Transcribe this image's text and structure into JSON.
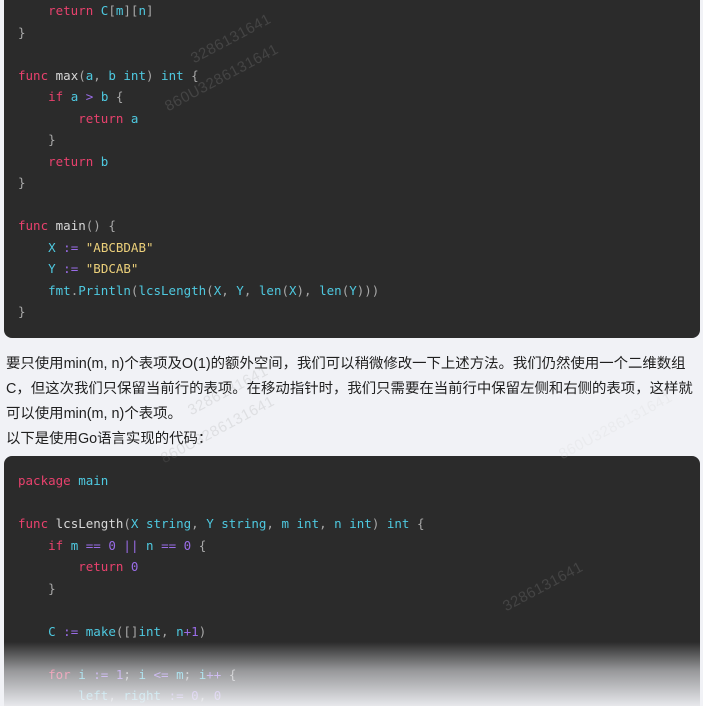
{
  "page": {
    "background_color": "#f1f2f6",
    "code_background_color": "#2b2b2b",
    "text_color": "#1f1f1f"
  },
  "watermark": {
    "text": "860U3286131641",
    "short_text": "3286131641"
  },
  "code_block_1": {
    "language": "go",
    "lines": [
      [
        {
          "t": "    ",
          "c": "pn"
        },
        {
          "t": "return",
          "c": "kw"
        },
        {
          "t": " ",
          "c": "pn"
        },
        {
          "t": "C",
          "c": "typ"
        },
        {
          "t": "[",
          "c": "pn"
        },
        {
          "t": "m",
          "c": "typ"
        },
        {
          "t": "][",
          "c": "pn"
        },
        {
          "t": "n",
          "c": "typ"
        },
        {
          "t": "]",
          "c": "pn"
        }
      ],
      [
        {
          "t": "}",
          "c": "pn"
        }
      ],
      [],
      [
        {
          "t": "func",
          "c": "kw"
        },
        {
          "t": " ",
          "c": "pn"
        },
        {
          "t": "max",
          "c": "fn"
        },
        {
          "t": "(",
          "c": "pn"
        },
        {
          "t": "a",
          "c": "typ"
        },
        {
          "t": ", ",
          "c": "pn"
        },
        {
          "t": "b",
          "c": "typ"
        },
        {
          "t": " ",
          "c": "pn"
        },
        {
          "t": "int",
          "c": "typ"
        },
        {
          "t": ") ",
          "c": "pn"
        },
        {
          "t": "int",
          "c": "typ"
        },
        {
          "t": " {",
          "c": "pn"
        }
      ],
      [
        {
          "t": "    ",
          "c": "pn"
        },
        {
          "t": "if",
          "c": "kw"
        },
        {
          "t": " ",
          "c": "pn"
        },
        {
          "t": "a",
          "c": "typ"
        },
        {
          "t": " ",
          "c": "pn"
        },
        {
          "t": ">",
          "c": "op"
        },
        {
          "t": " ",
          "c": "pn"
        },
        {
          "t": "b",
          "c": "typ"
        },
        {
          "t": " {",
          "c": "pn"
        }
      ],
      [
        {
          "t": "        ",
          "c": "pn"
        },
        {
          "t": "return",
          "c": "kw"
        },
        {
          "t": " ",
          "c": "pn"
        },
        {
          "t": "a",
          "c": "typ"
        }
      ],
      [
        {
          "t": "    }",
          "c": "pn"
        }
      ],
      [
        {
          "t": "    ",
          "c": "pn"
        },
        {
          "t": "return",
          "c": "kw"
        },
        {
          "t": " ",
          "c": "pn"
        },
        {
          "t": "b",
          "c": "typ"
        }
      ],
      [
        {
          "t": "}",
          "c": "pn"
        }
      ],
      [],
      [
        {
          "t": "func",
          "c": "kw"
        },
        {
          "t": " ",
          "c": "pn"
        },
        {
          "t": "main",
          "c": "fn"
        },
        {
          "t": "() {",
          "c": "pn"
        }
      ],
      [
        {
          "t": "    ",
          "c": "pn"
        },
        {
          "t": "X",
          "c": "typ"
        },
        {
          "t": " ",
          "c": "pn"
        },
        {
          "t": ":=",
          "c": "op"
        },
        {
          "t": " ",
          "c": "pn"
        },
        {
          "t": "\"ABCBDAB\"",
          "c": "str"
        }
      ],
      [
        {
          "t": "    ",
          "c": "pn"
        },
        {
          "t": "Y",
          "c": "typ"
        },
        {
          "t": " ",
          "c": "pn"
        },
        {
          "t": ":=",
          "c": "op"
        },
        {
          "t": " ",
          "c": "pn"
        },
        {
          "t": "\"BDCAB\"",
          "c": "str"
        }
      ],
      [
        {
          "t": "    ",
          "c": "pn"
        },
        {
          "t": "fmt",
          "c": "typ"
        },
        {
          "t": ".",
          "c": "pn"
        },
        {
          "t": "Println",
          "c": "typ"
        },
        {
          "t": "(",
          "c": "pn"
        },
        {
          "t": "lcsLength",
          "c": "typ"
        },
        {
          "t": "(",
          "c": "pn"
        },
        {
          "t": "X",
          "c": "typ"
        },
        {
          "t": ", ",
          "c": "pn"
        },
        {
          "t": "Y",
          "c": "typ"
        },
        {
          "t": ", ",
          "c": "pn"
        },
        {
          "t": "len",
          "c": "typ"
        },
        {
          "t": "(",
          "c": "pn"
        },
        {
          "t": "X",
          "c": "typ"
        },
        {
          "t": "), ",
          "c": "pn"
        },
        {
          "t": "len",
          "c": "typ"
        },
        {
          "t": "(",
          "c": "pn"
        },
        {
          "t": "Y",
          "c": "typ"
        },
        {
          "t": ")))",
          "c": "pn"
        }
      ],
      [
        {
          "t": "}",
          "c": "pn"
        }
      ]
    ]
  },
  "prose": {
    "paragraph": "要只使用min(m, n)个表项及O(1)的额外空间，我们可以稍微修改一下上述方法。我们仍然使用一个二维数组C，但这次我们只保留当前行的表项。在移动指针时，我们只需要在当前行中保留左侧和右侧的表项，这样就可以使用min(m, n)个表项。",
    "lead_in": "以下是使用Go语言实现的代码："
  },
  "code_block_2": {
    "language": "go",
    "lines": [
      [
        {
          "t": "package",
          "c": "kw"
        },
        {
          "t": " ",
          "c": "pn"
        },
        {
          "t": "main",
          "c": "typ"
        }
      ],
      [],
      [
        {
          "t": "func",
          "c": "kw"
        },
        {
          "t": " ",
          "c": "pn"
        },
        {
          "t": "lcsLength",
          "c": "fn"
        },
        {
          "t": "(",
          "c": "pn"
        },
        {
          "t": "X",
          "c": "typ"
        },
        {
          "t": " ",
          "c": "pn"
        },
        {
          "t": "string",
          "c": "typ"
        },
        {
          "t": ", ",
          "c": "pn"
        },
        {
          "t": "Y",
          "c": "typ"
        },
        {
          "t": " ",
          "c": "pn"
        },
        {
          "t": "string",
          "c": "typ"
        },
        {
          "t": ", ",
          "c": "pn"
        },
        {
          "t": "m",
          "c": "typ"
        },
        {
          "t": " ",
          "c": "pn"
        },
        {
          "t": "int",
          "c": "typ"
        },
        {
          "t": ", ",
          "c": "pn"
        },
        {
          "t": "n",
          "c": "typ"
        },
        {
          "t": " ",
          "c": "pn"
        },
        {
          "t": "int",
          "c": "typ"
        },
        {
          "t": ") ",
          "c": "pn"
        },
        {
          "t": "int",
          "c": "typ"
        },
        {
          "t": " {",
          "c": "pn"
        }
      ],
      [
        {
          "t": "    ",
          "c": "pn"
        },
        {
          "t": "if",
          "c": "kw"
        },
        {
          "t": " ",
          "c": "pn"
        },
        {
          "t": "m",
          "c": "typ"
        },
        {
          "t": " ",
          "c": "pn"
        },
        {
          "t": "==",
          "c": "op"
        },
        {
          "t": " ",
          "c": "pn"
        },
        {
          "t": "0",
          "c": "num"
        },
        {
          "t": " ",
          "c": "pn"
        },
        {
          "t": "||",
          "c": "op"
        },
        {
          "t": " ",
          "c": "pn"
        },
        {
          "t": "n",
          "c": "typ"
        },
        {
          "t": " ",
          "c": "pn"
        },
        {
          "t": "==",
          "c": "op"
        },
        {
          "t": " ",
          "c": "pn"
        },
        {
          "t": "0",
          "c": "num"
        },
        {
          "t": " {",
          "c": "pn"
        }
      ],
      [
        {
          "t": "        ",
          "c": "pn"
        },
        {
          "t": "return",
          "c": "kw"
        },
        {
          "t": " ",
          "c": "pn"
        },
        {
          "t": "0",
          "c": "num"
        }
      ],
      [
        {
          "t": "    }",
          "c": "pn"
        }
      ],
      [],
      [
        {
          "t": "    ",
          "c": "pn"
        },
        {
          "t": "C",
          "c": "typ"
        },
        {
          "t": " ",
          "c": "pn"
        },
        {
          "t": ":=",
          "c": "op"
        },
        {
          "t": " ",
          "c": "pn"
        },
        {
          "t": "make",
          "c": "typ"
        },
        {
          "t": "([]",
          "c": "pn"
        },
        {
          "t": "int",
          "c": "typ"
        },
        {
          "t": ", ",
          "c": "pn"
        },
        {
          "t": "n",
          "c": "typ"
        },
        {
          "t": "+",
          "c": "op"
        },
        {
          "t": "1",
          "c": "num"
        },
        {
          "t": ")",
          "c": "pn"
        }
      ],
      [],
      [
        {
          "t": "    ",
          "c": "pn"
        },
        {
          "t": "for",
          "c": "kw"
        },
        {
          "t": " ",
          "c": "pn"
        },
        {
          "t": "i",
          "c": "typ"
        },
        {
          "t": " ",
          "c": "pn"
        },
        {
          "t": ":=",
          "c": "op"
        },
        {
          "t": " ",
          "c": "pn"
        },
        {
          "t": "1",
          "c": "num"
        },
        {
          "t": "; ",
          "c": "pn"
        },
        {
          "t": "i",
          "c": "typ"
        },
        {
          "t": " ",
          "c": "pn"
        },
        {
          "t": "<=",
          "c": "op"
        },
        {
          "t": " ",
          "c": "pn"
        },
        {
          "t": "m",
          "c": "typ"
        },
        {
          "t": "; ",
          "c": "pn"
        },
        {
          "t": "i",
          "c": "typ"
        },
        {
          "t": "++",
          "c": "op"
        },
        {
          "t": " {",
          "c": "pn"
        }
      ],
      [
        {
          "t": "        ",
          "c": "pn"
        },
        {
          "t": "left",
          "c": "typ"
        },
        {
          "t": ", ",
          "c": "pn"
        },
        {
          "t": "right",
          "c": "typ"
        },
        {
          "t": " ",
          "c": "pn"
        },
        {
          "t": ":=",
          "c": "op"
        },
        {
          "t": " ",
          "c": "pn"
        },
        {
          "t": "0",
          "c": "num"
        },
        {
          "t": ", ",
          "c": "pn"
        },
        {
          "t": "0",
          "c": "num"
        }
      ]
    ]
  }
}
